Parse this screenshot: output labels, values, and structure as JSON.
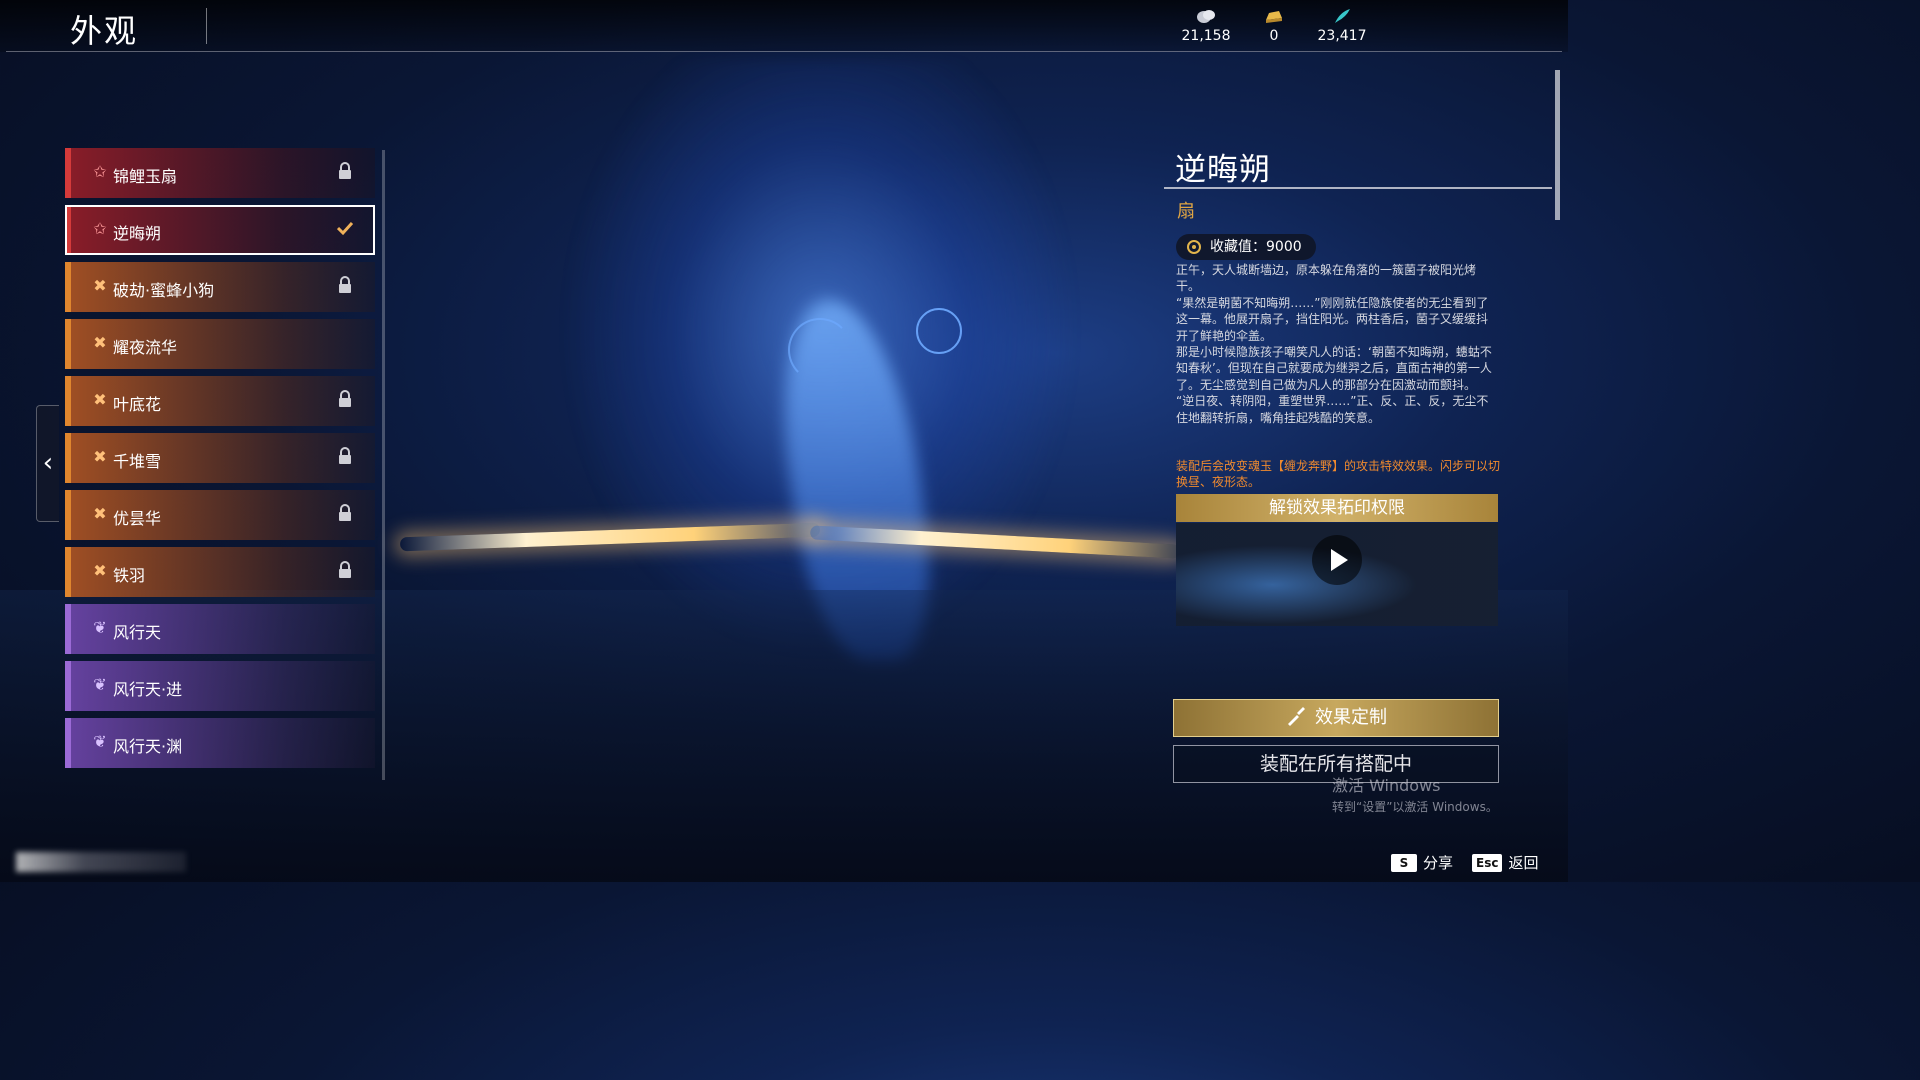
{
  "header": {
    "title": "外观",
    "currencies": [
      {
        "icon": "coin-pouch-icon",
        "value": "21,158"
      },
      {
        "icon": "gold-ingot-icon",
        "value": "0"
      },
      {
        "icon": "feather-icon",
        "value": "23,417"
      }
    ]
  },
  "list": {
    "items": [
      {
        "name": "锦鲤玉扇",
        "rarity": "red",
        "icon": "star-icon",
        "state": "locked"
      },
      {
        "name": "逆晦朔",
        "rarity": "red",
        "icon": "star-icon",
        "state": "equipped",
        "selected": true
      },
      {
        "name": "破劫·蜜蜂小狗",
        "rarity": "orange",
        "icon": "cross-icon",
        "state": "locked"
      },
      {
        "name": "耀夜流华",
        "rarity": "orange",
        "icon": "cross-icon",
        "state": "none"
      },
      {
        "name": "叶底花",
        "rarity": "orange",
        "icon": "cross-icon",
        "state": "locked"
      },
      {
        "name": "千堆雪",
        "rarity": "orange",
        "icon": "cross-icon",
        "state": "locked"
      },
      {
        "name": "优昙华",
        "rarity": "orange",
        "icon": "cross-icon",
        "state": "locked"
      },
      {
        "name": "铁羽",
        "rarity": "orange",
        "icon": "cross-icon",
        "state": "locked"
      },
      {
        "name": "风行天",
        "rarity": "purple",
        "icon": "wing-icon",
        "state": "none"
      },
      {
        "name": "风行天·进",
        "rarity": "purple",
        "icon": "wing-icon",
        "state": "none"
      },
      {
        "name": "风行天·渊",
        "rarity": "purple",
        "icon": "wing-icon",
        "state": "none"
      }
    ]
  },
  "detail": {
    "name": "逆晦朔",
    "type": "扇",
    "collection": "收藏值：9000",
    "description": [
      "正午，天人城断墙边，原本躲在角落的一簇菌子被阳光烤干。",
      "“果然是朝菌不知晦朔……”刚刚就任隐族使者的无尘看到了这一幕。他展开扇子，挡住阳光。两柱香后，菌子又缓缓抖开了鲜艳的伞盖。",
      "那是小时候隐族孩子嘲笑凡人的话：‘朝菌不知晦朔，蟪蛄不知春秋’。但现在自己就要成为继羿之后，直面古神的第一人了。无尘感觉到自己做为凡人的那部分在因激动而颤抖。",
      "“逆日夜、转阴阳，重塑世界……”正、反、正、反，无尘不住地翻转折扇，嘴角挂起残酷的笑意。"
    ],
    "effect_note": "装配后会改变魂玉【缠龙奔野】的攻击特效效果。闪步可以切换昼、夜形态。",
    "video_title": "解锁效果拓印权限",
    "custom_button": "效果定制",
    "equip_button": "装配在所有搭配中"
  },
  "watermark": {
    "line1": "激活 Windows",
    "line2": "转到“设置”以激活 Windows。"
  },
  "footer": {
    "share_key": "S",
    "share_label": "分享",
    "back_key": "Esc",
    "back_label": "返回"
  },
  "colors": {
    "red": "#d43a3a",
    "orange": "#e0862e",
    "purple": "#9b6ad6",
    "gold": "#c7a85e",
    "effect_text": "#f08a2e"
  }
}
